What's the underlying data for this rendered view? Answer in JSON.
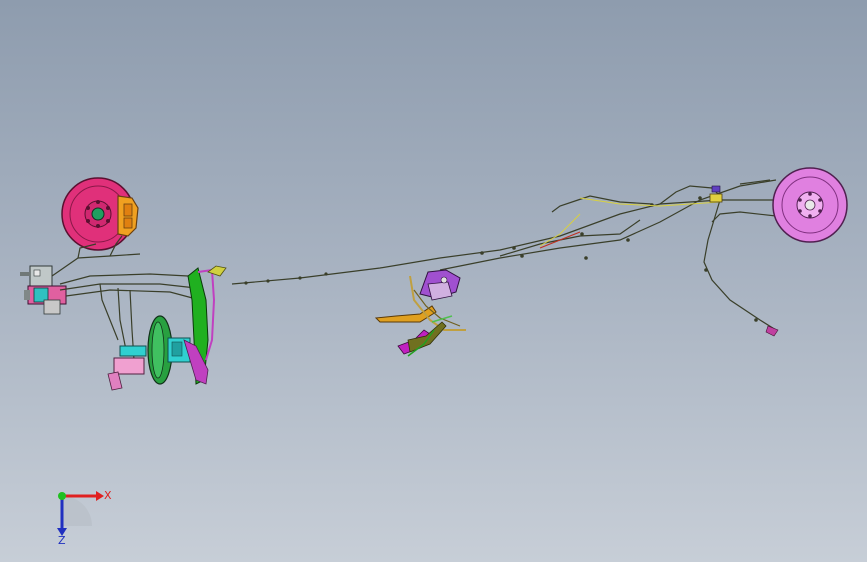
{
  "viewport": {
    "background_top": "#8e9cae",
    "background_bottom": "#c7ced7"
  },
  "colors": {
    "front_rotor": "#e0307a",
    "front_caliper": "#f0a020",
    "rear_rotor": "#e080e0",
    "brake_line": "#3a3f2a",
    "booster": "#28a040",
    "booster_housing": "#30d0d0",
    "pedal": "#20b020",
    "pedal_bracket": "#c040c0",
    "pedal_pink": "#f0a0d0",
    "park_brake_lever": "#a050d0",
    "park_brake_arm": "#e0a020",
    "park_brake_foot": "#c020c0",
    "abs_module": "#30c0c0",
    "yellow_line": "#e0d040"
  },
  "triad": {
    "x_label": "X",
    "z_label": "Z",
    "x_color": "#e02020",
    "y_color": "#20c020",
    "z_color": "#2030c0"
  }
}
